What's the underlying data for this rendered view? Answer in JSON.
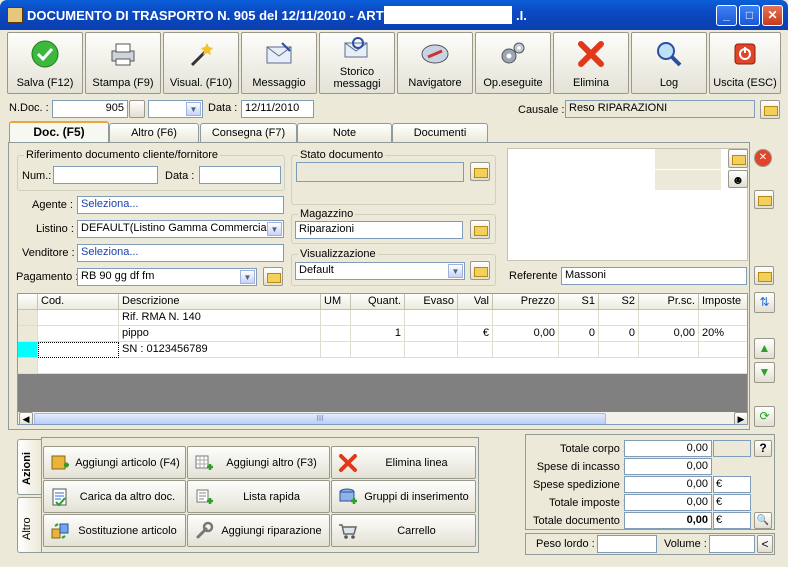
{
  "window": {
    "title": "DOCUMENTO DI TRASPORTO N.  905   del 12/11/2010  - ART",
    "title_tail": ".I.",
    "minimize_icon": "minimize-icon",
    "maximize_icon": "maximize-icon",
    "close_icon": "close-icon"
  },
  "toolbar": [
    {
      "label": "Salva (F12)",
      "icon": "check-icon"
    },
    {
      "label": "Stampa (F9)",
      "icon": "printer-icon"
    },
    {
      "label": "Visual. (F10)",
      "icon": "magic-wand-icon"
    },
    {
      "label": "Messaggio",
      "icon": "envelope-icon"
    },
    {
      "label": "Storico messaggi",
      "icon": "mail-search-icon"
    },
    {
      "label": "Navigatore",
      "icon": "compass-icon"
    },
    {
      "label": "Op.eseguite",
      "icon": "gears-icon"
    },
    {
      "label": "Elimina",
      "icon": "delete-x-icon"
    },
    {
      "label": "Log",
      "icon": "log-search-icon"
    },
    {
      "label": "Uscita (ESC)",
      "icon": "exit-icon"
    }
  ],
  "header": {
    "ndoc_label": "N.Doc. :",
    "ndoc_value": "905",
    "data_label": "Data :",
    "data_value": "12/11/2010",
    "causale_label": "Causale :",
    "causale_value": "Reso RIPARAZIONI"
  },
  "tabs": [
    "Doc. (F5)",
    "Altro (F6)",
    "Consegna (F7)",
    "Note",
    "Documenti"
  ],
  "doc": {
    "rif_title": "Riferimento documento cliente/fornitore",
    "num_label": "Num.:",
    "num_value": "",
    "rif_data_label": "Data :",
    "rif_data_value": "",
    "agente_label": "Agente :",
    "agente_value": "Seleziona...",
    "listino_label": "Listino :",
    "listino_value": "DEFAULT(Listino Gamma Commerciale",
    "venditore_label": "Venditore :",
    "venditore_value": "Seleziona...",
    "pagamento_label": "Pagamento :",
    "pagamento_value": "RB 90 gg df fm",
    "stato_title": "Stato documento",
    "stato_value": "",
    "magazzino_title": "Magazzino",
    "magazzino_value": "Riparazioni",
    "visual_title": "Visualizzazione",
    "visual_value": "Default",
    "referente_label": "Referente",
    "referente_value": "Massoni"
  },
  "grid": {
    "columns": [
      "Cod.",
      "Descrizione",
      "UM",
      "Quant.",
      "Evaso",
      "Val",
      "Prezzo",
      "S1",
      "S2",
      "Pr.sc.",
      "Imposte"
    ],
    "rows": [
      {
        "cod": "",
        "descr": "Rif. RMA N. 140",
        "um": "",
        "quant": "",
        "evaso": "",
        "val": "",
        "prezzo": "",
        "s1": "",
        "s2": "",
        "prsc": "",
        "imposte": ""
      },
      {
        "cod": "",
        "descr": "pippo",
        "um": "",
        "quant": "1",
        "evaso": "",
        "val": "€",
        "prezzo": "0,00",
        "s1": "0",
        "s2": "0",
        "prsc": "0,00",
        "imposte": "20%"
      },
      {
        "cod": "",
        "descr": "SN : 0123456789",
        "um": "",
        "quant": "",
        "evaso": "",
        "val": "",
        "prezzo": "",
        "s1": "",
        "s2": "",
        "prsc": "",
        "imposte": ""
      }
    ],
    "scroll_grip": "III"
  },
  "side_tabs": [
    "Azioni",
    "Altro"
  ],
  "actions": [
    {
      "label": "Aggiungi articolo (F4)",
      "icon": "add-article-icon"
    },
    {
      "label": "Aggiungi altro (F3)",
      "icon": "add-other-icon"
    },
    {
      "label": "Elimina linea",
      "icon": "delete-line-icon"
    },
    {
      "label": "Carica da altro doc.",
      "icon": "load-doc-icon"
    },
    {
      "label": "Lista rapida",
      "icon": "quick-list-icon"
    },
    {
      "label": "Gruppi di inserimento",
      "icon": "insert-groups-icon"
    },
    {
      "label": "Sostituzione articolo",
      "icon": "replace-article-icon"
    },
    {
      "label": "Aggiungi riparazione",
      "icon": "wrench-icon"
    },
    {
      "label": "Carrello",
      "icon": "cart-icon"
    }
  ],
  "totals": {
    "corpo_label": "Totale corpo :",
    "corpo_value": "0,00",
    "incasso_label": "Spese di incasso :",
    "incasso_value": "0,00",
    "spedizione_label": "Spese spedizione :",
    "spedizione_value": "0,00",
    "spedizione_unit": "€",
    "imposte_label": "Totale imposte :",
    "imposte_value": "0,00",
    "imposte_unit": "€",
    "documento_label": "Totale documento :",
    "documento_value": "0,00",
    "documento_unit": "€",
    "help": "?"
  },
  "footer": {
    "peso_label": "Peso lordo :",
    "peso_value": "",
    "volume_label": "Volume :",
    "volume_value": "",
    "arrow": "<"
  },
  "colors": {
    "accent": "#0a5fd8",
    "selected_cell": "#00ffff",
    "tab_highlight": "#e6a83e"
  }
}
